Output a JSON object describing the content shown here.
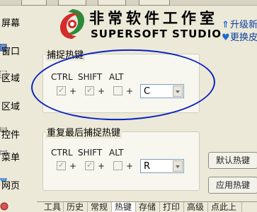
{
  "sidebar": {
    "items": [
      {
        "label": "屏幕"
      },
      {
        "label": "窗口"
      },
      {
        "label": "区域"
      },
      {
        "label": "区域"
      },
      {
        "label": "控件"
      },
      {
        "label": "菜单"
      },
      {
        "label": "网页"
      }
    ]
  },
  "header": {
    "logo_cn": "非常软件工作室",
    "logo_en": "SUPERSOFT STUDIO",
    "links": [
      {
        "label": "升级新"
      },
      {
        "label": "更换皮"
      }
    ]
  },
  "capture_hotkey": {
    "title": "捕捉热键",
    "ctrl_label": "CTRL",
    "shift_label": "SHIFT",
    "alt_label": "ALT",
    "plus": "+",
    "key_value": "C"
  },
  "repeat_hotkey": {
    "title": "重复最后捕捉热键",
    "ctrl_label": "CTRL",
    "shift_label": "SHIFT",
    "alt_label": "ALT",
    "plus": "+",
    "key_value": "R"
  },
  "buttons": {
    "default_hotkey": "默认热键",
    "apply_hotkey": "应用热键"
  },
  "tabs": [
    "工具",
    "历史",
    "常规",
    "热键",
    "存储",
    "打印",
    "高级",
    "点此上"
  ],
  "colors": {
    "annotation_ellipse": "#0a22c0",
    "link": "#0b3f9e",
    "logo_red": "#d42b2b",
    "logo_green": "#2c8a3a"
  }
}
